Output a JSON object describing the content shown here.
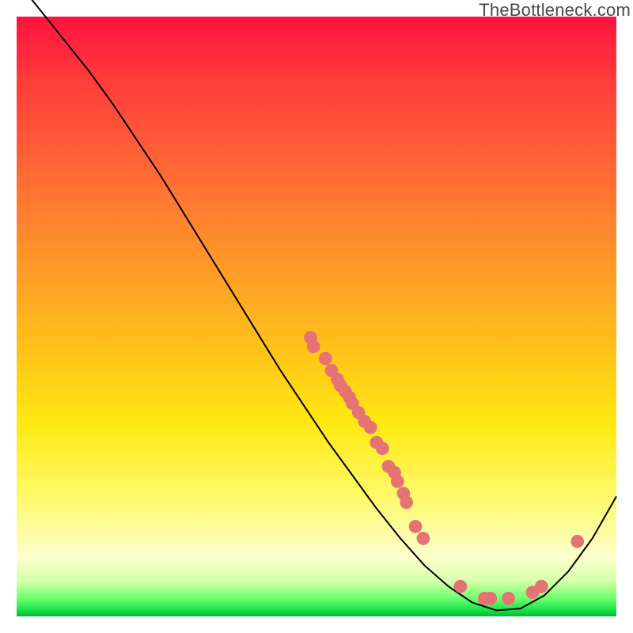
{
  "watermark": "TheBottleneck.com",
  "chart_data": {
    "type": "line",
    "title": "",
    "xlabel": "",
    "ylabel": "",
    "xlim": [
      0,
      100
    ],
    "ylim": [
      0,
      100
    ],
    "curve": {
      "x": [
        0,
        4,
        8,
        12,
        16,
        20,
        24,
        28,
        32,
        36,
        40,
        44,
        48,
        52,
        56,
        60,
        64,
        68,
        72,
        76,
        80,
        84,
        88,
        92,
        96,
        100
      ],
      "y": [
        106,
        101,
        96,
        91,
        85.5,
        79.5,
        73.5,
        67,
        60.5,
        54,
        47.5,
        41,
        35,
        29,
        23.5,
        18,
        13,
        8.5,
        5,
        2.3,
        1,
        1.3,
        3.5,
        7.5,
        13,
        20
      ]
    },
    "points": [
      {
        "x": 49.0,
        "y": 46.5
      },
      {
        "x": 49.5,
        "y": 45.0
      },
      {
        "x": 51.5,
        "y": 43.0
      },
      {
        "x": 52.5,
        "y": 41.0
      },
      {
        "x": 53.5,
        "y": 39.5
      },
      {
        "x": 54.0,
        "y": 38.5
      },
      {
        "x": 54.8,
        "y": 37.5
      },
      {
        "x": 55.5,
        "y": 36.5
      },
      {
        "x": 56.0,
        "y": 35.5
      },
      {
        "x": 57.0,
        "y": 34.0
      },
      {
        "x": 58.0,
        "y": 32.5
      },
      {
        "x": 59.0,
        "y": 31.5
      },
      {
        "x": 60.0,
        "y": 29.0
      },
      {
        "x": 61.0,
        "y": 28.0
      },
      {
        "x": 62.0,
        "y": 25.0
      },
      {
        "x": 63.0,
        "y": 24.0
      },
      {
        "x": 63.5,
        "y": 22.5
      },
      {
        "x": 64.5,
        "y": 20.5
      },
      {
        "x": 65.0,
        "y": 19.0
      },
      {
        "x": 66.5,
        "y": 15.0
      },
      {
        "x": 67.8,
        "y": 13.0
      },
      {
        "x": 74.0,
        "y": 5.0
      },
      {
        "x": 78.0,
        "y": 3.0
      },
      {
        "x": 79.0,
        "y": 3.0
      },
      {
        "x": 82.0,
        "y": 3.0
      },
      {
        "x": 86.0,
        "y": 4.0
      },
      {
        "x": 87.5,
        "y": 5.0
      },
      {
        "x": 93.5,
        "y": 12.5
      }
    ],
    "point_color": "#e57373",
    "curve_color": "#000000"
  }
}
